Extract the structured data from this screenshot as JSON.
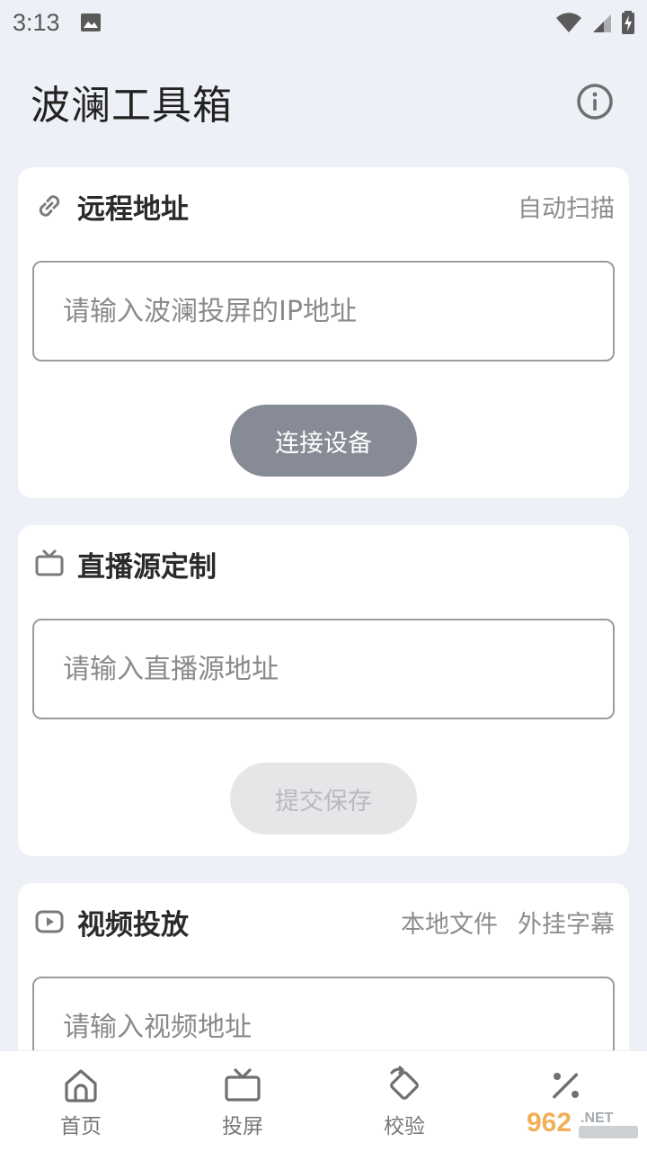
{
  "status_bar": {
    "time": "3:13"
  },
  "app_bar": {
    "title": "波澜工具箱"
  },
  "remote": {
    "title": "远程地址",
    "action": "自动扫描",
    "input_placeholder": "请输入波澜投屏的IP地址",
    "button": "连接设备"
  },
  "live": {
    "title": "直播源定制",
    "input_placeholder": "请输入直播源地址",
    "button": "提交保存"
  },
  "video": {
    "title": "视频投放",
    "action_local": "本地文件",
    "action_subtitle": "外挂字幕",
    "input_placeholder": "请输入视频地址"
  },
  "nav": {
    "items": [
      {
        "label": "首页",
        "icon": "home-icon"
      },
      {
        "label": "投屏",
        "icon": "tv-icon"
      },
      {
        "label": "校验",
        "icon": "verify-icon"
      },
      {
        "label": "",
        "icon": "percent-icon"
      }
    ]
  },
  "colors": {
    "background": "#eef0f7",
    "primary_button": "#878b95",
    "disabled_button": "#e6e6e9"
  }
}
